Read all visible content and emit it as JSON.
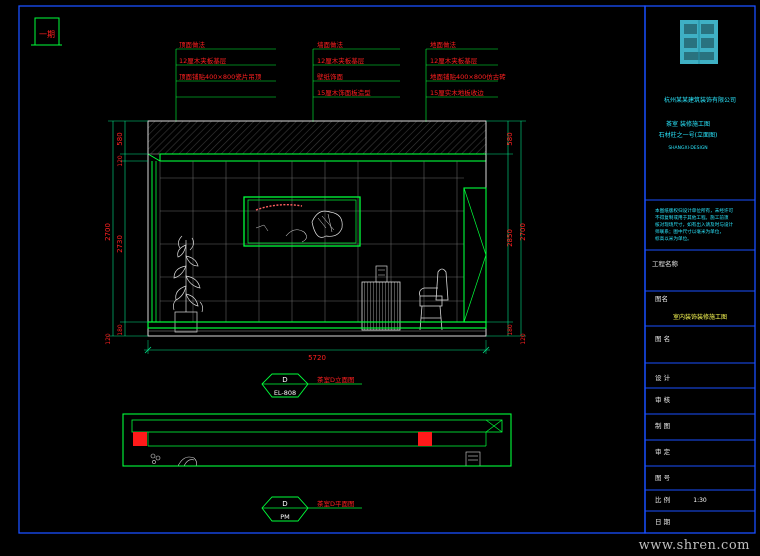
{
  "colors": {
    "background": "#000000",
    "frame": "#1a4fff",
    "cad_green": "#00ff3a",
    "annotation_red": "#ff2020",
    "dimension_green": "#00e68a",
    "light_text": "#ffffff",
    "cyan_text": "#2be8ff",
    "yellow_text": "#ffff55",
    "logo_teal": "#46c3d9"
  },
  "top_left_tag": "一期",
  "annotations": [
    {
      "title": "顶面做法",
      "lines": [
        "12厘木夹板基层",
        "顶面铺贴400×800瓷片吊顶",
        ""
      ]
    },
    {
      "title": "墙面做法",
      "lines": [
        "12厘木夹板基层",
        "壁纸饰面",
        "15厘木饰面板造型"
      ]
    },
    {
      "title": "地面做法",
      "lines": [
        "12厘木夹板基层",
        "地面铺贴400×800仿古砖",
        "15厘实木地板收边"
      ]
    }
  ],
  "dimensions": {
    "left_outer": "2700",
    "left_inner": "2730",
    "right_outer": "2700",
    "right_inner": "2850",
    "top_ceiling": "580",
    "top_cove": "120",
    "bottom_base": "180",
    "bottom_floor": "120",
    "width": "5720"
  },
  "elevation_tag": {
    "letter": "D",
    "sheet": "EL-808",
    "caption": "茶室D立面图"
  },
  "plan_tag": {
    "letter": "D",
    "sheet": "PM",
    "caption": "茶室D平面图"
  },
  "title_block": {
    "company": "杭州某某建筑装饰有限公司",
    "project_line1": "茶室 装修施工图",
    "project_line2": "石材柱之一号(立面图)",
    "project_small": "SHANGXI·DESIGN",
    "notes": [
      "本图纸版权归设计单位所有，未经许可",
      "不得复制或用于其他工程。施工前须",
      "核对现场尺寸，如有出入请及时与设计",
      "师联系；图中尺寸以毫米为单位，",
      "标高以米为单位。"
    ],
    "project_name_label": "工程名称",
    "category_label": "图名",
    "category_value": "室内装饰装修施工图",
    "drawing_name_label": "图 名",
    "design_label": "设 计",
    "review_label": "审 核",
    "draw_label": "制 图",
    "approve_label": "审 定",
    "number_label": "图 号",
    "scale_label": "比 例",
    "scale_value": "1:30",
    "date_label": "日 期"
  },
  "watermark": "www.shren.com"
}
